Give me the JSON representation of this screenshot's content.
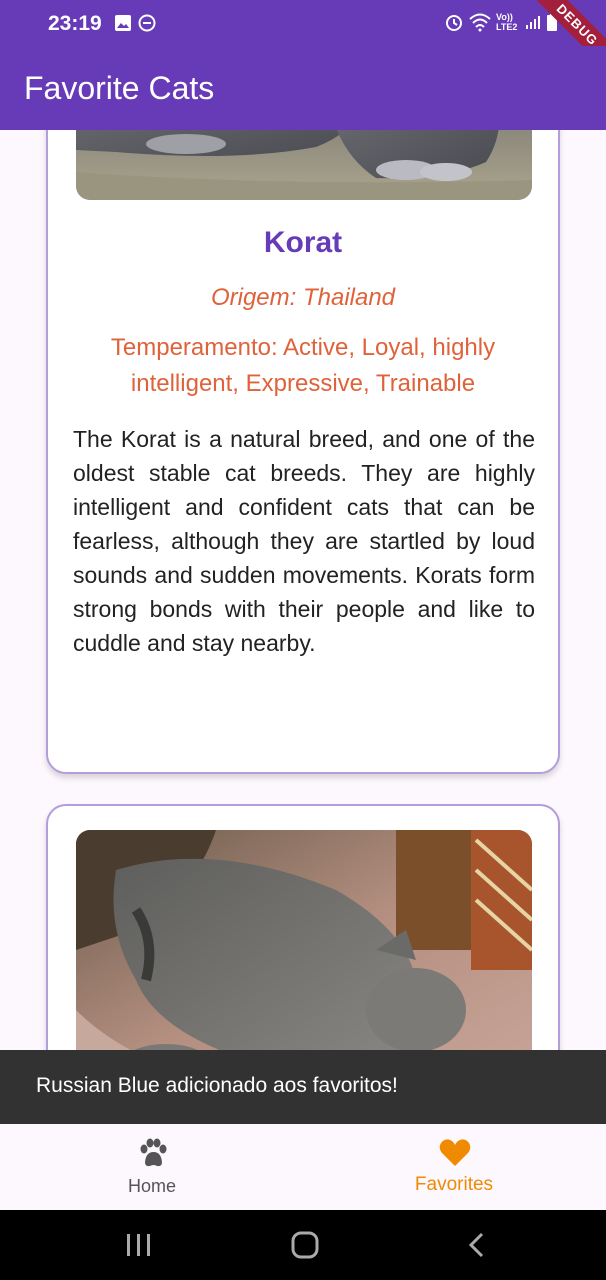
{
  "status_bar": {
    "time": "23:19",
    "debug_banner": "DEBUG",
    "network_label": "Vo)) LTE2"
  },
  "app_bar": {
    "title": "Favorite Cats"
  },
  "cards": [
    {
      "name": "Korat",
      "origin": "Origem: Thailand",
      "temperament": "Temperamento: Active, Loyal, highly intelligent, Expressive, Trainable",
      "description": "The Korat is a natural breed, and one of the oldest stable cat breeds. They are highly intelligent and confident cats that can be fearless, although they are startled by loud sounds and sudden movements. Korats form strong bonds with their people and like to cuddle and stay nearby."
    },
    {
      "name": "",
      "origin": "",
      "temperament": "",
      "description": ""
    }
  ],
  "snackbar": {
    "message": "Russian Blue adicionado aos favoritos!"
  },
  "bottom_nav": {
    "items": [
      {
        "label": "Home",
        "icon": "paw-icon",
        "selected": false
      },
      {
        "label": "Favorites",
        "icon": "heart-icon",
        "selected": true
      }
    ]
  },
  "colors": {
    "primary": "#673ab7",
    "accent_orange": "#e0623a",
    "selected_nav": "#f08a00",
    "card_border": "#b39ddb",
    "snackbar": "#323232"
  }
}
